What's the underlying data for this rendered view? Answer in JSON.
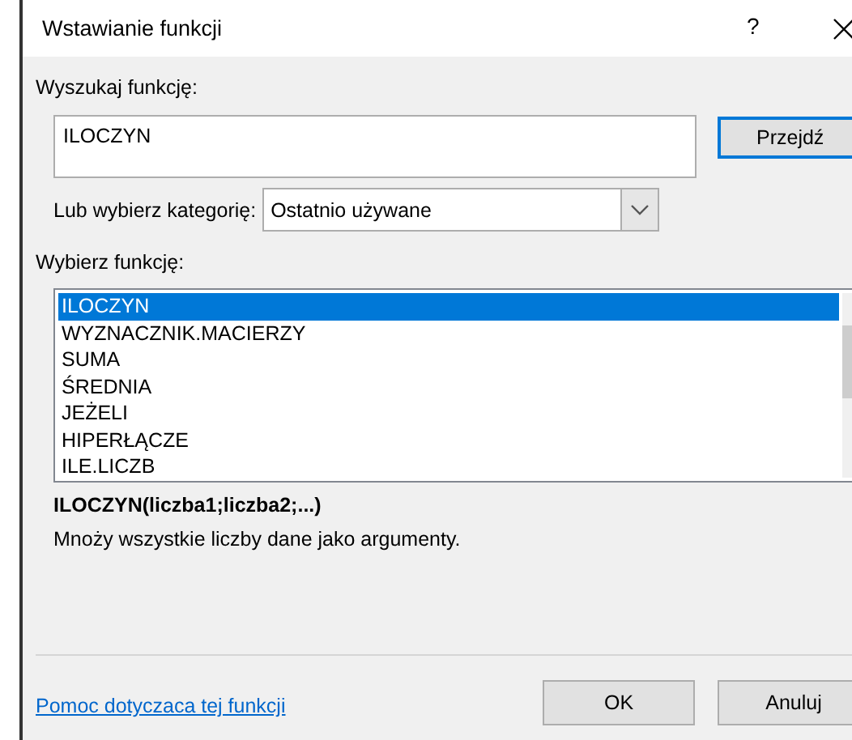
{
  "window": {
    "title": "Wstawianie funkcji",
    "help": "?"
  },
  "search": {
    "label": "Wyszukaj funkcję:",
    "value": "ILOCZYN",
    "button": "Przejdź"
  },
  "category": {
    "label": "Lub wybierz kategorię:",
    "value": "Ostatnio używane"
  },
  "functions": {
    "label": "Wybierz funkcję:",
    "items": [
      {
        "name": "ILOCZYN",
        "selected": true
      },
      {
        "name": "WYZNACZNIK.MACIERZY",
        "selected": false
      },
      {
        "name": "SUMA",
        "selected": false
      },
      {
        "name": "ŚREDNIA",
        "selected": false
      },
      {
        "name": "JEŻELI",
        "selected": false
      },
      {
        "name": "HIPERŁĄCZE",
        "selected": false
      },
      {
        "name": "ILE.LICZB",
        "selected": false
      }
    ]
  },
  "details": {
    "signature": "ILOCZYN(liczba1;liczba2;...)",
    "description": "Mnoży wszystkie liczby dane jako argumenty."
  },
  "footer": {
    "help_link": "Pomoc dotyczaca tej funkcji",
    "buttons": [
      "OK",
      "Anuluj"
    ]
  }
}
